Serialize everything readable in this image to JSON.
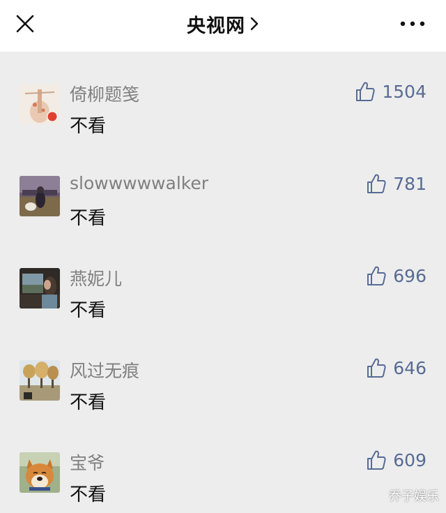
{
  "header": {
    "title": "央视网",
    "close_icon": "close-icon",
    "more_icon": "more-icon"
  },
  "colors": {
    "link_blue": "#576b95",
    "nickname_gray": "#808080"
  },
  "comments": [
    {
      "nickname": "倚柳题笺",
      "text": "不看",
      "likes": "1504"
    },
    {
      "nickname": "slowwwwwalker",
      "text": "不看",
      "likes": "781"
    },
    {
      "nickname": "燕妮儿",
      "text": "不看",
      "likes": "696"
    },
    {
      "nickname": "风过无痕",
      "text": "不看",
      "likes": "646"
    },
    {
      "nickname": "宝爷",
      "text": "不看",
      "likes": "609"
    }
  ],
  "watermark": "乔子娱乐"
}
